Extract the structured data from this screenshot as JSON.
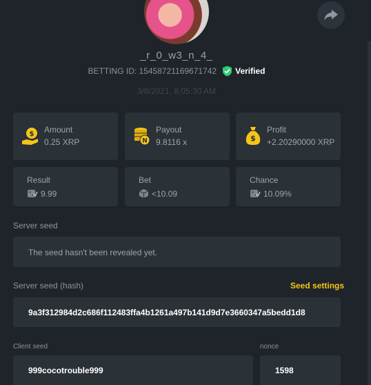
{
  "profile": {
    "username": "_r_0_w3_n_4_",
    "betting_id": "BETTING ID: 15458721169671742",
    "verified_label": "Verified",
    "date": "3/8/2021, 8:05:30 AM"
  },
  "stats_top": [
    {
      "label": "Amount",
      "value": "0.25 XRP",
      "icon": "coin-hand-icon"
    },
    {
      "label": "Payout",
      "value": "9.8116 x",
      "icon": "coin-stack-icon"
    },
    {
      "label": "Profit",
      "value": "+2.20290000 XRP",
      "icon": "money-bag-icon"
    }
  ],
  "stats_bottom": [
    {
      "label": "Result",
      "value": "9.99",
      "icon": "dice-icon"
    },
    {
      "label": "Bet",
      "value": "<10.09",
      "icon": "cube-icon"
    },
    {
      "label": "Chance",
      "value": "10.09%",
      "icon": "dice-icon"
    }
  ],
  "server_seed": {
    "label": "Server seed",
    "value": "The seed hasn't been revealed yet."
  },
  "server_seed_hash": {
    "label": "Server seed (hash)",
    "settings_link": "Seed settings",
    "value": "9a3f312984d2c686f112483ffa4b1261a497b141d9d7e3660347a5bedd1d8"
  },
  "client_seed": {
    "label": "Client seed",
    "value": "999cocotrouble999"
  },
  "nonce": {
    "label": "nonce",
    "value": "1598"
  },
  "colors": {
    "accent": "#f5c518",
    "verified": "#2ecc71",
    "background": "#1e2429",
    "card": "#2a3137"
  }
}
